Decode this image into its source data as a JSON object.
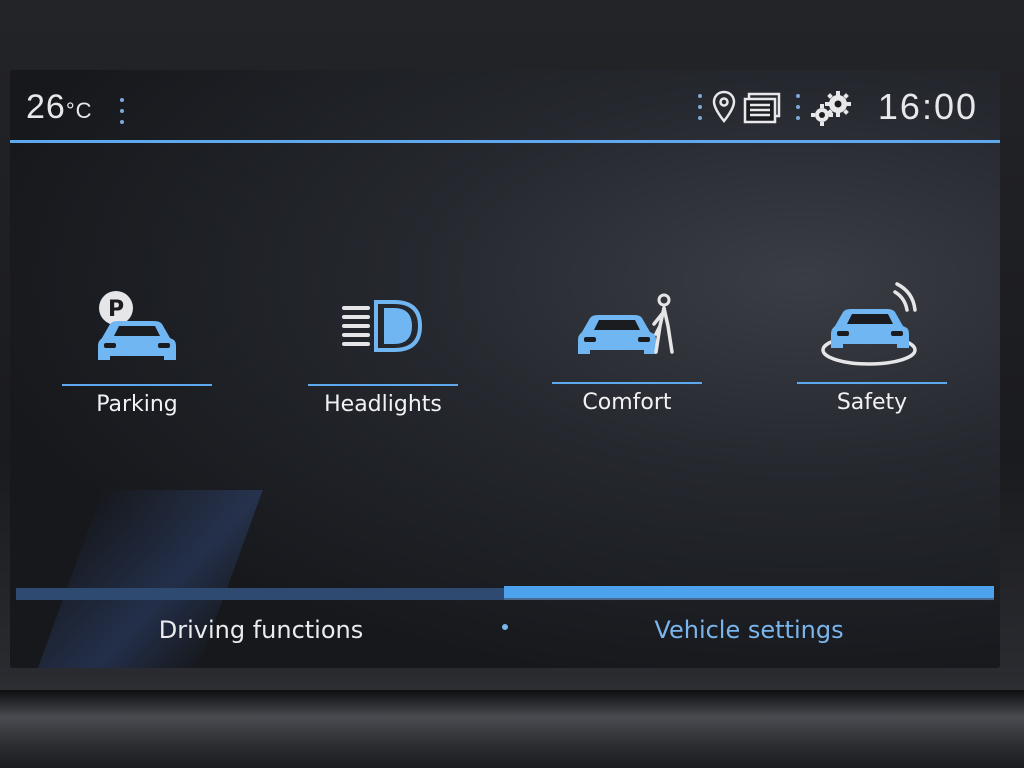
{
  "status_bar": {
    "temperature": "26",
    "temperature_unit": "°C",
    "time": "16:00"
  },
  "menu": {
    "tiles": [
      {
        "label": "Parking",
        "icon": "parking-car-icon"
      },
      {
        "label": "Headlights",
        "icon": "headlight-icon"
      },
      {
        "label": "Comfort",
        "icon": "car-person-icon"
      },
      {
        "label": "Safety",
        "icon": "car-radar-icon"
      }
    ]
  },
  "tabs": {
    "left": {
      "label": "Driving functions",
      "selected": false
    },
    "right": {
      "label": "Vehicle settings",
      "selected": true
    }
  },
  "colors": {
    "accent": "#5ea8ee",
    "icon": "#6fb6f2",
    "text": "#f2f2f4",
    "selected_tab_text": "#7ab6ee"
  }
}
